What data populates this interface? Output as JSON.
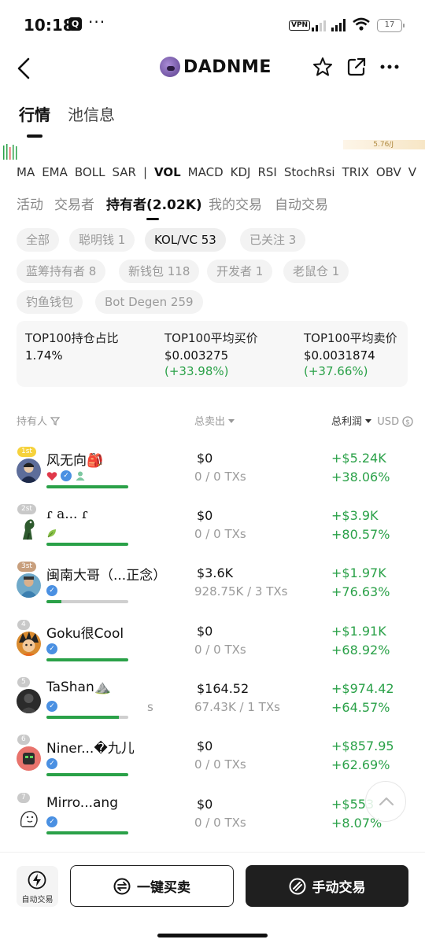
{
  "status_bar": {
    "time": "10:18",
    "app_badge": "Q",
    "dots": "···",
    "vpn": "VPN",
    "battery": "17"
  },
  "header": {
    "title": "DADNME"
  },
  "main_tabs": [
    {
      "label": "行情",
      "active": true
    },
    {
      "label": "池信息",
      "active": false
    }
  ],
  "chart_strip": {
    "right_value": "5.76/J"
  },
  "indicators": [
    "MA",
    "EMA",
    "BOLL",
    "SAR",
    "|",
    "VOL",
    "MACD",
    "KDJ",
    "RSI",
    "StochRsi",
    "TRIX",
    "OBV",
    "V"
  ],
  "selected_indicator": "VOL",
  "sub_tabs": [
    {
      "label": "活动",
      "active": false
    },
    {
      "label": "交易者",
      "active": false
    },
    {
      "label": "持有者(2.02K)",
      "active": true
    },
    {
      "label": "我的交易",
      "active": false
    },
    {
      "label": "自动交易",
      "active": false
    }
  ],
  "filter_chips": [
    {
      "label": "全部",
      "active": false
    },
    {
      "label": "聪明钱 1",
      "active": false
    },
    {
      "label": "KOL/VC 53",
      "active": true
    },
    {
      "label": "已关注 3",
      "active": false
    },
    {
      "label": "蓝筹持有者 8",
      "active": false
    },
    {
      "label": "新钱包 118",
      "active": false
    },
    {
      "label": "开发者 1",
      "active": false
    },
    {
      "label": "老鼠仓 1",
      "active": false
    },
    {
      "label": "钓鱼钱包",
      "active": false
    },
    {
      "label": "Bot Degen 259",
      "active": false
    }
  ],
  "stats": [
    {
      "label": "TOP100持仓占比",
      "value": "1.74%",
      "change": ""
    },
    {
      "label": "TOP100平均买价",
      "value": "$0.003275",
      "change": "(+33.98%)"
    },
    {
      "label": "TOP100平均卖价",
      "value": "$0.0031874",
      "change": "(+37.66%)"
    }
  ],
  "columns": {
    "holder": "持有人",
    "sold": "总卖出",
    "profit": "总利润",
    "currency": "USD"
  },
  "holders": [
    {
      "rank": "1st",
      "name": "风无向🎒",
      "sold": "$0",
      "txs": "0 / 0 TXs",
      "profit": "+$5.24K",
      "profit_pct": "+38.06%",
      "hold_ratio": 1.0
    },
    {
      "rank": "2st",
      "name": "ɾ a... ɾ",
      "sold": "$0",
      "txs": "0 / 0 TXs",
      "profit": "+$3.9K",
      "profit_pct": "+80.57%",
      "hold_ratio": 1.0
    },
    {
      "rank": "3st",
      "name": "闽南大哥（...正念）",
      "sold": "$3.6K",
      "txs": "928.75K / 3 TXs",
      "profit": "+$1.97K",
      "profit_pct": "+76.63%",
      "hold_ratio": 0.18
    },
    {
      "rank": "4",
      "name": "Goku很Cool",
      "sold": "$0",
      "txs": "0 / 0 TXs",
      "profit": "+$1.91K",
      "profit_pct": "+68.92%",
      "hold_ratio": 1.0
    },
    {
      "rank": "5",
      "name": "TaShan⛰️",
      "sold": "$164.52",
      "txs": "67.43K / 1 TXs",
      "profit": "+$974.42",
      "profit_pct": "+64.57%",
      "hold_ratio": 0.88
    },
    {
      "rank": "6",
      "name": "Niner...�九儿",
      "sold": "$0",
      "txs": "0 / 0 TXs",
      "profit": "+$857.95",
      "profit_pct": "+62.69%",
      "hold_ratio": 1.0
    },
    {
      "rank": "7",
      "name": "Mirro...ang",
      "sold": "$0",
      "txs": "0 / 0 TXs",
      "profit": "+$553",
      "profit_pct": "+8.07%",
      "hold_ratio": 1.0
    }
  ],
  "stray_char": "s",
  "bottom_bar": {
    "auto_label": "自动交易",
    "one_click": "一键买卖",
    "manual": "手动交易"
  },
  "colors": {
    "green": "#2aa148",
    "dark_button": "#1f1f1f",
    "verified": "#4a90e2"
  }
}
